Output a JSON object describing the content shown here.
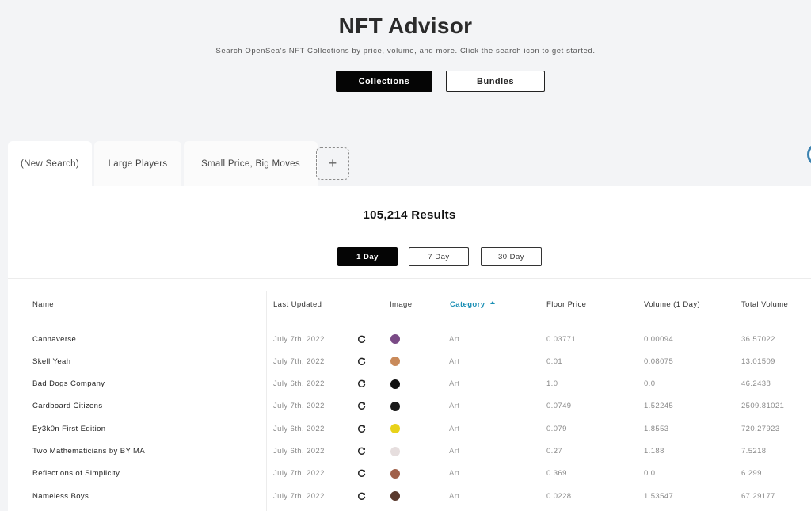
{
  "header": {
    "title": "NFT Advisor",
    "subtitle": "Search OpenSea's NFT Collections by price, volume, and more. Click the search icon to get started.",
    "collections_label": "Collections",
    "bundles_label": "Bundles"
  },
  "tabs": [
    {
      "label": "(New Search)"
    },
    {
      "label": "Large Players"
    },
    {
      "label": "Small Price, Big Moves"
    }
  ],
  "add_tab_label": "+",
  "results": {
    "count_text": "105,214 Results"
  },
  "periods": [
    "1 Day",
    "7 Day",
    "30 Day"
  ],
  "table": {
    "headers": {
      "name": "Name",
      "last_updated": "Last Updated",
      "image": "Image",
      "category": "Category",
      "floor_price": "Floor Price",
      "volume": "Volume (1 Day)",
      "total_volume": "Total Volume"
    },
    "sorted_column": "category",
    "sort_direction": "ascending",
    "rows": [
      {
        "name": "Cannaverse",
        "date": "July 7th, 2022",
        "category": "Art",
        "floor": "0.03771",
        "volume": "0.00094",
        "total": "36.57022",
        "thumb_color": "#7a4a86"
      },
      {
        "name": "Skell Yeah",
        "date": "July 7th, 2022",
        "category": "Art",
        "floor": "0.01",
        "volume": "0.08075",
        "total": "13.01509",
        "thumb_color": "#c98a5a"
      },
      {
        "name": "Bad Dogs Company",
        "date": "July 6th, 2022",
        "category": "Art",
        "floor": "1.0",
        "volume": "0.0",
        "total": "46.2438",
        "thumb_color": "#111111"
      },
      {
        "name": "Cardboard Citizens",
        "date": "July 7th, 2022",
        "category": "Art",
        "floor": "0.0749",
        "volume": "1.52245",
        "total": "2509.81021",
        "thumb_color": "#1a1a1a"
      },
      {
        "name": "Ey3k0n First Edition",
        "date": "July 6th, 2022",
        "category": "Art",
        "floor": "0.079",
        "volume": "1.8553",
        "total": "720.27923",
        "thumb_color": "#e8d21a"
      },
      {
        "name": "Two Mathematicians by BY MA",
        "date": "July 6th, 2022",
        "category": "Art",
        "floor": "0.27",
        "volume": "1.188",
        "total": "7.5218",
        "thumb_color": "#e6dede"
      },
      {
        "name": "Reflections of Simplicity",
        "date": "July 7th, 2022",
        "category": "Art",
        "floor": "0.369",
        "volume": "0.0",
        "total": "6.299",
        "thumb_color": "#a0604a"
      },
      {
        "name": "Nameless Boys",
        "date": "July 7th, 2022",
        "category": "Art",
        "floor": "0.0228",
        "volume": "1.53547",
        "total": "67.29177",
        "thumb_color": "#5a3a2e"
      }
    ]
  },
  "icons": {
    "refresh": "refresh-icon",
    "sort": "sort-ascending-icon"
  }
}
